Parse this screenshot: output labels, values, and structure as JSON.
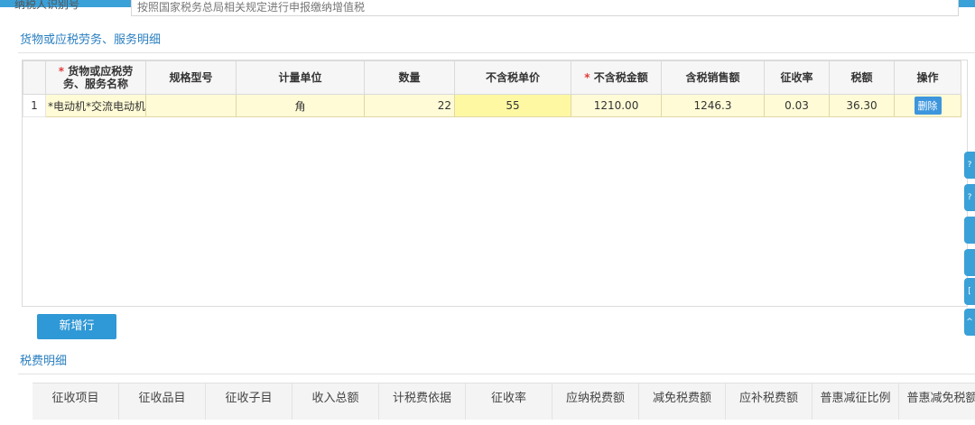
{
  "previous_field": {
    "label": "纳税人识别号",
    "value": "按照国家税务总局相关规定进行申报缴纳增值税"
  },
  "goods_section": {
    "title": "货物或应税劳务、服务明细",
    "columns": [
      "*货物或应税劳务、服务名称",
      "规格型号",
      "计量单位",
      "数量",
      "不含税单价",
      "*不含税金额",
      "含税销售额",
      "征收率",
      "税额",
      "操作"
    ],
    "header_parts": {
      "name_line1": "货物或应税劳",
      "name_line2": "务、服务名称",
      "spec": "规格型号",
      "unit": "计量单位",
      "qty": "数量",
      "price": "不含税单价",
      "amount": "不含税金额",
      "incl": "含税销售额",
      "rate": "征收率",
      "tax": "税额",
      "op": "操作",
      "asterisk": "*"
    },
    "rows": [
      {
        "index": "1",
        "name": "*电动机*交流电动机",
        "spec": "",
        "unit": "角",
        "quantity": "22",
        "unit_price": "55",
        "amount": "1210.00",
        "incl_tax": "1246.3",
        "rate": "0.03",
        "tax": "36.30",
        "action": "删除"
      }
    ],
    "add_row_label": "新增行"
  },
  "fee_section": {
    "title": "税费明细",
    "columns": [
      "征收项目",
      "征收品目",
      "征收子目",
      "收入总额",
      "计税费依据",
      "征收率",
      "应纳税费额",
      "减免税费额",
      "应补税费额",
      "普惠减征比例",
      "普惠减免税额"
    ]
  },
  "side_tabs": [
    "?",
    "?",
    "",
    "",
    "[",
    "^"
  ],
  "colors": {
    "accent": "#2f98d6",
    "row_highlight": "#fffbd6",
    "required": "#e23a3a"
  }
}
